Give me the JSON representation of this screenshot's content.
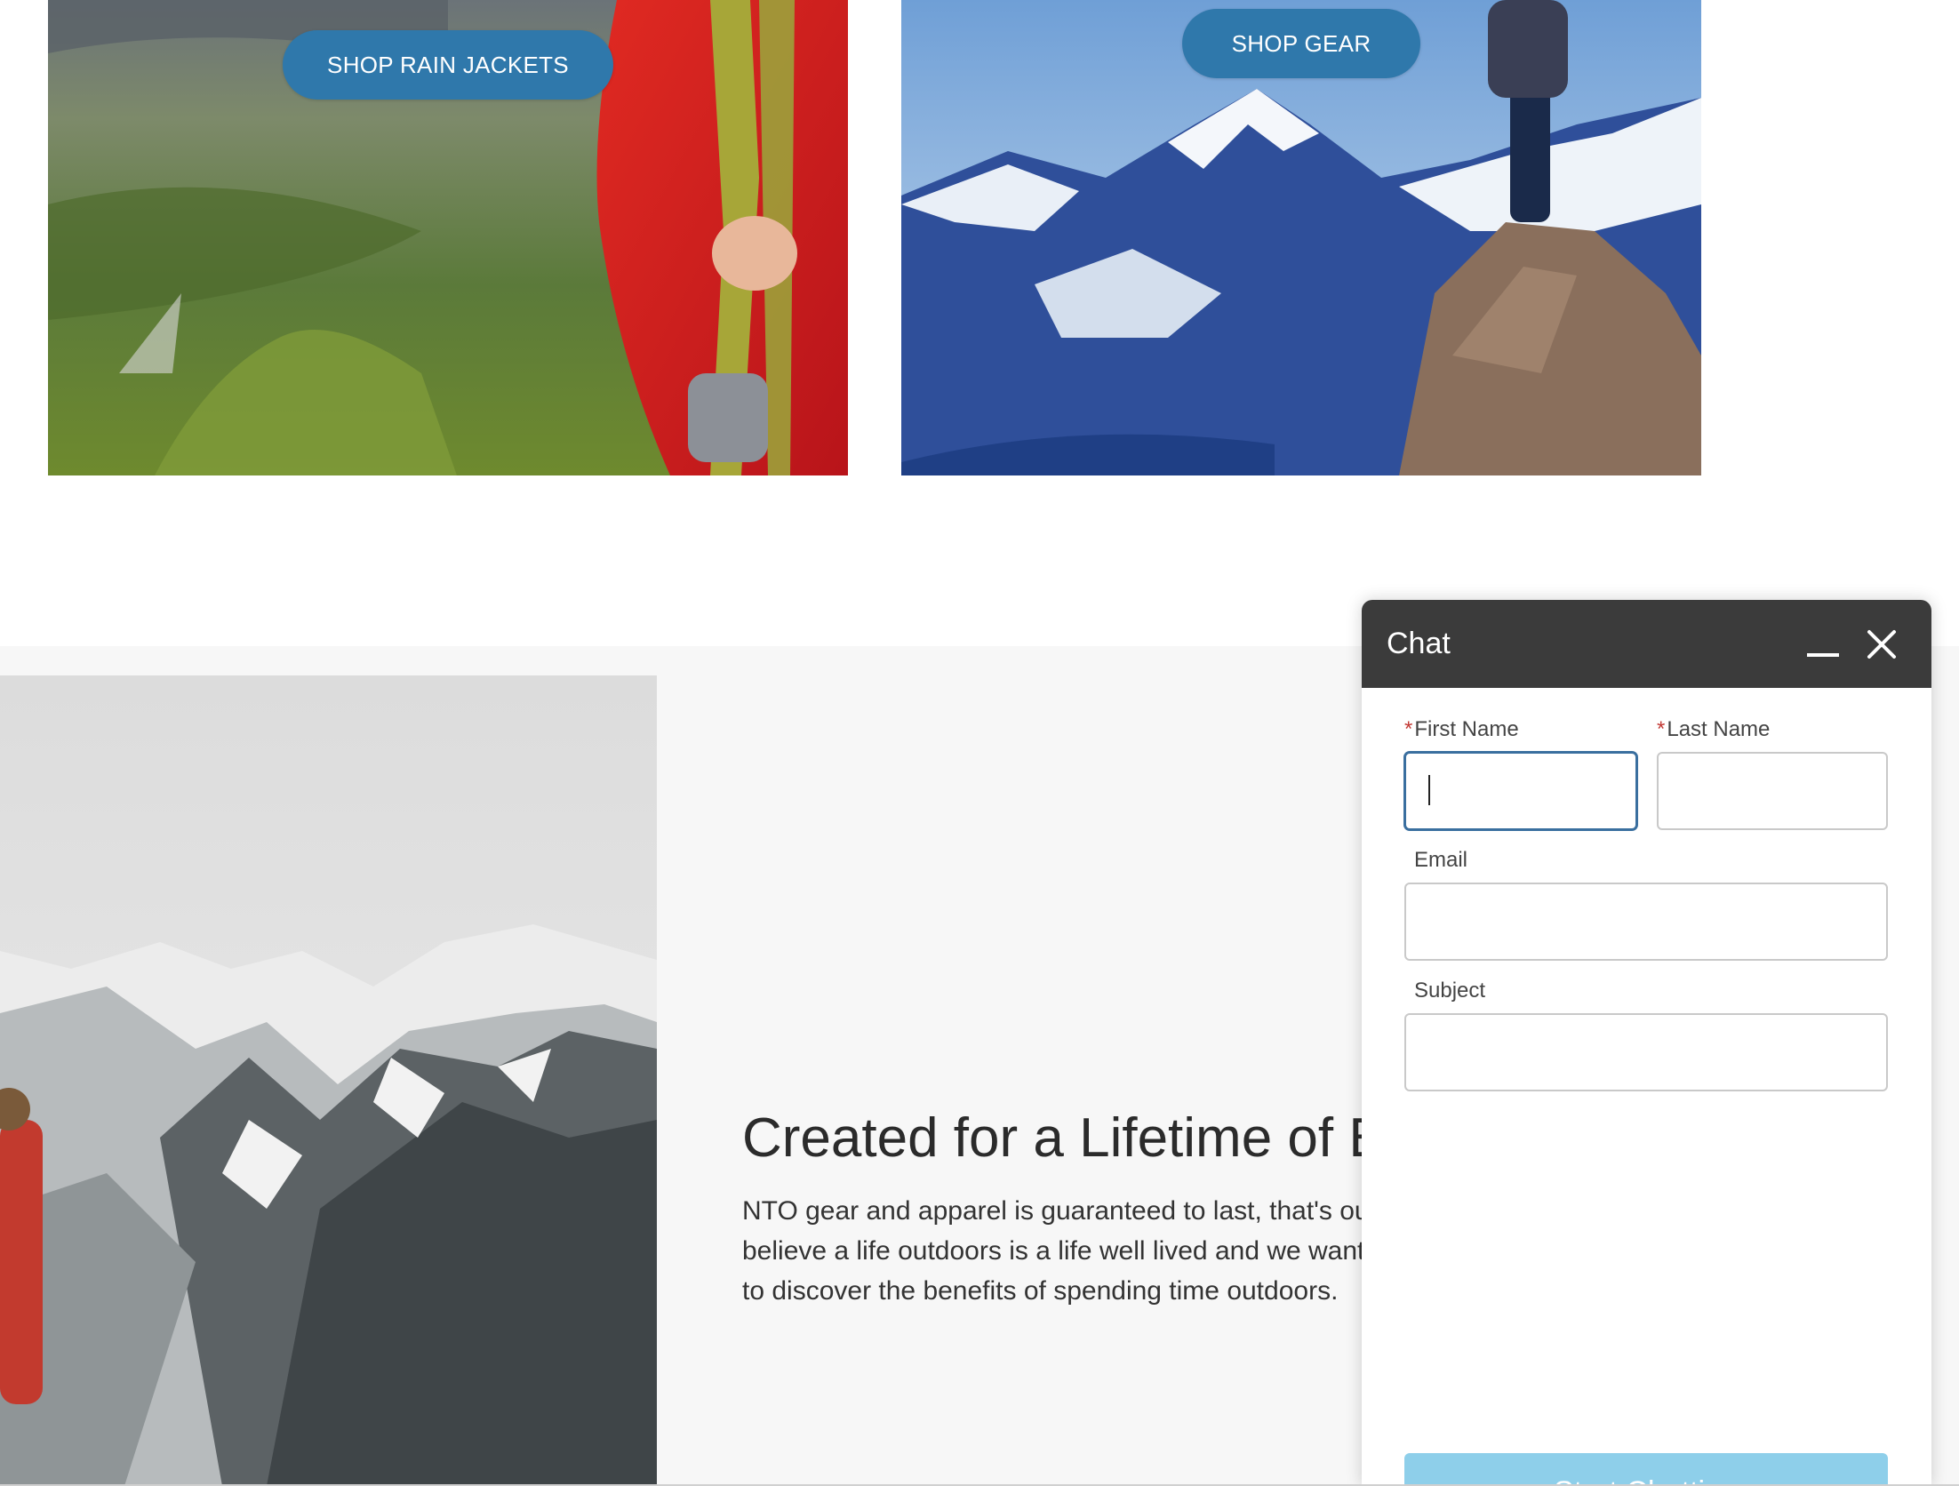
{
  "promos": [
    {
      "button_label": "SHOP RAIN JACKETS"
    },
    {
      "button_label": "SHOP GEAR"
    }
  ],
  "feature": {
    "title": "Created for a Lifetime of Ex",
    "body": "NTO gear and apparel is guaranteed to last, that's ou believe a life outdoors is a life well lived and we want to discover the benefits of spending time outdoors."
  },
  "chat": {
    "title": "Chat",
    "fields": {
      "first_name": {
        "label": "First Name",
        "required_mark": "*",
        "value": ""
      },
      "last_name": {
        "label": "Last Name",
        "required_mark": "*",
        "value": ""
      },
      "email": {
        "label": "Email",
        "value": ""
      },
      "subject": {
        "label": "Subject",
        "value": ""
      }
    },
    "start_label": "Start Chatting",
    "start_color": "#8ecfea"
  },
  "icons": {
    "minimize": "minimize-icon",
    "close": "close-icon"
  },
  "colors": {
    "accent": "#2f78ab",
    "chat_header": "#3b3b3b",
    "focus": "#3a6f9f"
  }
}
